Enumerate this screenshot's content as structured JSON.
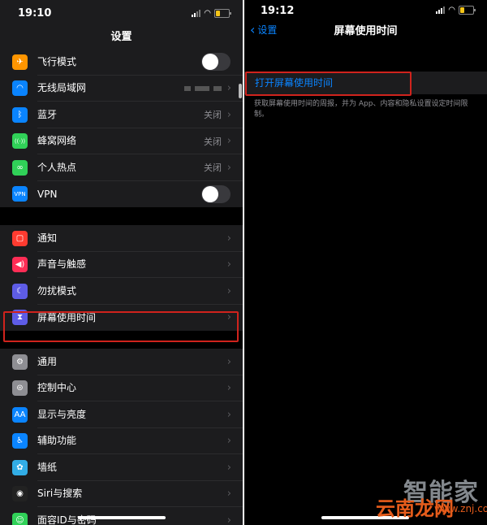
{
  "left": {
    "status": {
      "time": "19:10"
    },
    "title": "设置",
    "group1": [
      {
        "label": "飞行模式",
        "icon": "airplane-icon",
        "color": "#ff9500",
        "glyph": "✈",
        "toggle": true
      },
      {
        "label": "无线局域网",
        "icon": "wifi-icon",
        "color": "#0a84ff",
        "glyph": "◠",
        "wifi_blurred": true
      },
      {
        "label": "蓝牙",
        "icon": "bluetooth-icon",
        "color": "#0a84ff",
        "glyph": "ᛒ",
        "value": "关闭"
      },
      {
        "label": "蜂窝网络",
        "icon": "cellular-icon",
        "color": "#30d158",
        "glyph": "((·))",
        "value": "关闭"
      },
      {
        "label": "个人热点",
        "icon": "hotspot-icon",
        "color": "#30d158",
        "glyph": "∞",
        "value": "关闭"
      },
      {
        "label": "VPN",
        "icon": "vpn-icon",
        "color": "#0a84ff",
        "glyph": "VPN",
        "toggle": true
      }
    ],
    "group2": [
      {
        "label": "通知",
        "icon": "notifications-icon",
        "color": "#ff3b30",
        "glyph": "▢"
      },
      {
        "label": "声音与触感",
        "icon": "sound-icon",
        "color": "#ff2d55",
        "glyph": "◀)"
      },
      {
        "label": "勿扰模式",
        "icon": "moon-icon",
        "color": "#5e5ce6",
        "glyph": "☾"
      },
      {
        "label": "屏幕使用时间",
        "icon": "hourglass-icon",
        "color": "#5e5ce6",
        "glyph": "⧗"
      }
    ],
    "group3": [
      {
        "label": "通用",
        "icon": "gear-icon",
        "color": "#8e8e93",
        "glyph": "⚙"
      },
      {
        "label": "控制中心",
        "icon": "control-center-icon",
        "color": "#8e8e93",
        "glyph": "⊜"
      },
      {
        "label": "显示与亮度",
        "icon": "display-icon",
        "color": "#0a84ff",
        "glyph": "AA"
      },
      {
        "label": "辅助功能",
        "icon": "accessibility-icon",
        "color": "#0a84ff",
        "glyph": "♿"
      },
      {
        "label": "墙纸",
        "icon": "wallpaper-icon",
        "color": "#32ade6",
        "glyph": "✿"
      },
      {
        "label": "Siri与搜索",
        "icon": "siri-icon",
        "color": "#222222",
        "glyph": "◉"
      },
      {
        "label": "面容ID与密码",
        "icon": "faceid-icon",
        "color": "#30d158",
        "glyph": "☺"
      }
    ]
  },
  "right": {
    "status": {
      "time": "19:12"
    },
    "back_label": "设置",
    "title": "屏幕使用时间",
    "turn_on_label": "打开屏幕使用时间",
    "description": "获取屏幕使用时间的周报，并为 App、内容和隐私设置设定时间限制。"
  },
  "watermark": {
    "line1": "智能家",
    "line2": "云南龙网",
    "line3": "www.znj.com"
  },
  "colors": {
    "accent": "#0a84ff",
    "highlight": "#d0231d",
    "background": "#000000",
    "cell": "#1c1c1e"
  }
}
